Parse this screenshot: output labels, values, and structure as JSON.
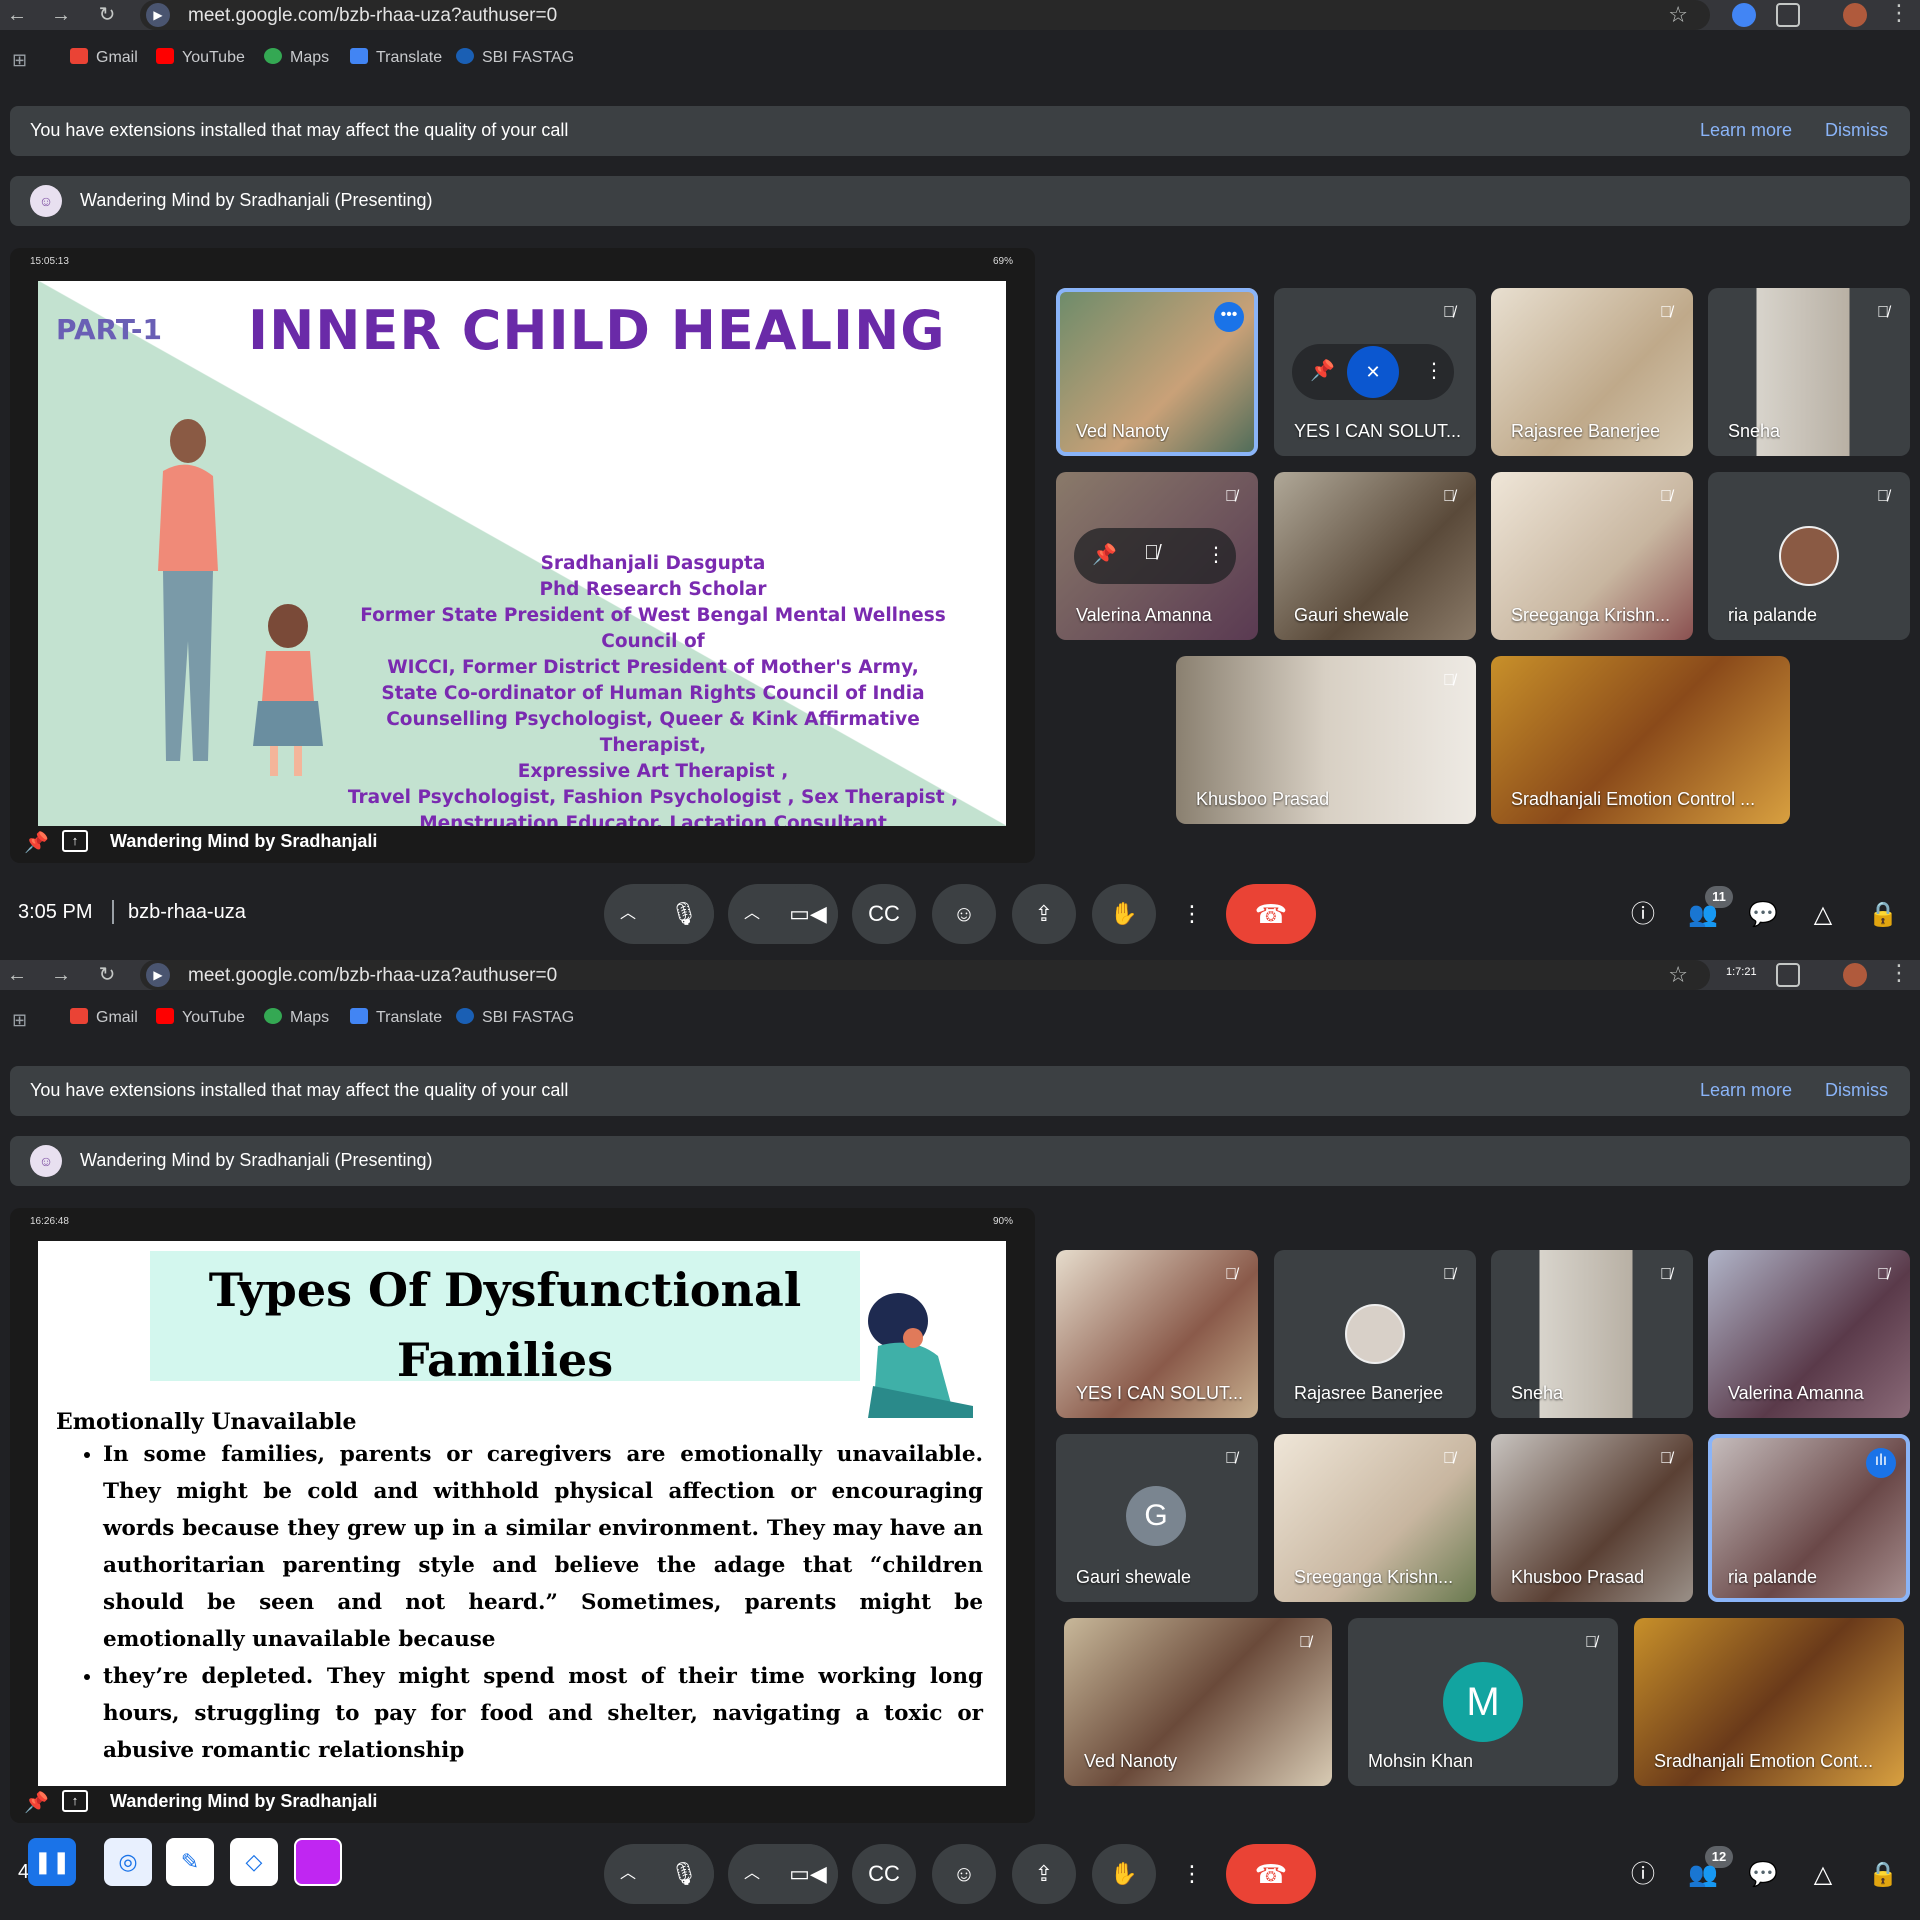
{
  "browser": {
    "url": "meet.google.com/bzb-rhaa-uza?authuser=0",
    "bookmarks": [
      "Gmail",
      "YouTube",
      "Maps",
      "Translate",
      "SBI FASTAG"
    ],
    "extension_timer": "1:7:21"
  },
  "banner": {
    "message": "You have extensions installed that may affect the quality of your call",
    "learn_more": "Learn more",
    "dismiss": "Dismiss"
  },
  "presenting": {
    "label": "Wandering Mind by Sradhanjali (Presenting)",
    "footer_name": "Wandering Mind by Sradhanjali"
  },
  "top": {
    "phone_time": "15:05:13",
    "phone_battery": "69%",
    "slide": {
      "part": "PART-1",
      "title": "INNER CHILD HEALING",
      "credits": [
        "Sradhanjali Dasgupta",
        "Phd Research Scholar",
        "Former State President of West Bengal Mental Wellness Council of",
        "WICCI, Former District President of Mother's Army,",
        "State Co-ordinator of Human Rights Council of India",
        "Counselling Psychologist, Queer  & Kink Affirmative Therapist,",
        "Expressive Art Therapist ,",
        "Travel Psychologist, Fashion Psychologist , Sex Therapist ,",
        "Menstruation Educator, Lactation Consultant"
      ]
    },
    "participants": [
      {
        "name": "Ved Nanoty"
      },
      {
        "name": "YES I CAN SOLUT..."
      },
      {
        "name": "Rajasree Banerjee"
      },
      {
        "name": "Sneha"
      },
      {
        "name": "Valerina Amanna"
      },
      {
        "name": "Gauri shewale"
      },
      {
        "name": "Sreeganga Krishn..."
      },
      {
        "name": "ria palande"
      },
      {
        "name": "Khusboo Prasad"
      },
      {
        "name": "Sradhanjali Emotion Control ..."
      }
    ],
    "time": "3:05 PM",
    "meeting_code": "bzb-rhaa-uza",
    "people_count": "11"
  },
  "bottom": {
    "phone_time": "16:26:48",
    "phone_battery": "90%",
    "slide": {
      "title_line1": "Types Of Dysfunctional",
      "title_line2": "Families",
      "subtitle": "Emotionally Unavailable",
      "bullets": [
        "In some families, parents or caregivers are emotionally unavailable. They might be cold and withhold physical affection or encouraging words because they grew up in a similar environment. They may have an authoritarian parenting style and believe the adage that “children should be seen and not heard.” Sometimes, parents might be emotionally unavailable because",
        "they’re depleted. They might spend most of their time working long hours, struggling to pay for food and shelter, navigating a toxic or abusive romantic relationship"
      ]
    },
    "participants": [
      {
        "name": "YES I CAN SOLUT..."
      },
      {
        "name": "Rajasree Banerjee"
      },
      {
        "name": "Sneha"
      },
      {
        "name": "Valerina Amanna"
      },
      {
        "name": "Gauri shewale",
        "initial": "G"
      },
      {
        "name": "Sreeganga Krishn..."
      },
      {
        "name": "Khusboo Prasad"
      },
      {
        "name": "ria palande"
      },
      {
        "name": "Ved Nanoty"
      },
      {
        "name": "Mohsin Khan",
        "initial": "M"
      },
      {
        "name": "Sradhanjali Emotion Cont..."
      }
    ],
    "time_partial": "4",
    "people_count": "12"
  },
  "colors": {
    "background": "#202124",
    "tile": "#3c4043",
    "accent": "#8ab4f8",
    "end_call": "#ea4335",
    "slide_title_purple": "#6a2aa8",
    "annotation_purple": "#c026f2"
  }
}
